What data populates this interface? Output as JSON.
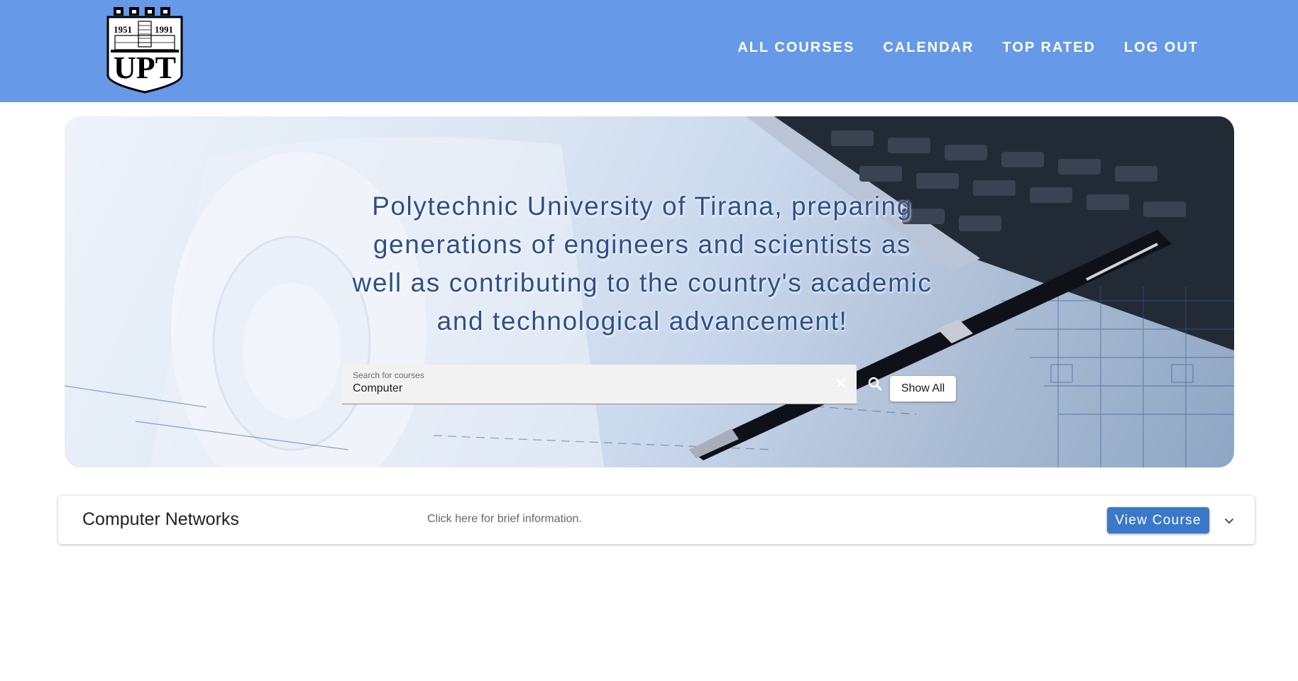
{
  "header": {
    "logo": {
      "years_left": "1951",
      "years_right": "1991",
      "text": "UPT"
    },
    "nav": [
      {
        "label": "ALL COURSES"
      },
      {
        "label": "CALENDAR"
      },
      {
        "label": "TOP RATED"
      },
      {
        "label": "LOG OUT"
      }
    ]
  },
  "hero": {
    "title": "Polytechnic University of Tirana, preparing generations of engineers and scientists as well as contributing to the country's academic and technological advancement!",
    "search": {
      "label": "Search for courses",
      "value": "Computer"
    },
    "show_all_label": "Show All"
  },
  "courses": [
    {
      "name": "Computer Networks",
      "info": "Click here for brief information.",
      "button_label": "View Course"
    }
  ],
  "colors": {
    "header_bg": "#6699e8",
    "primary_button": "#3a78c9",
    "hero_text": "#2d5088"
  }
}
